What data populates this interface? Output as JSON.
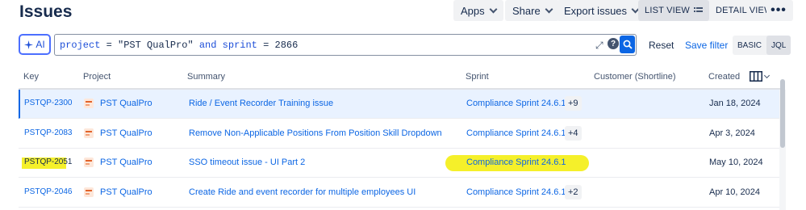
{
  "page": {
    "title": "Issues"
  },
  "toolbar": {
    "apps": "Apps",
    "share": "Share",
    "export": "Export issues",
    "list_view": "LIST VIEW",
    "detail_view": "DETAIL VIEW",
    "more": "•••"
  },
  "search": {
    "ai_label": "AI",
    "query_parts": {
      "field1": "project",
      "op1": " = ",
      "value1": "\"PST QualPro\"",
      "and": " and ",
      "field2": "sprint",
      "op2": " = ",
      "value2": "2866"
    },
    "reset": "Reset",
    "save_filter": "Save filter",
    "mode_basic": "BASIC",
    "mode_jql": "JQL"
  },
  "table": {
    "columns": [
      "Key",
      "Project",
      "Summary",
      "Sprint",
      "Customer (Shortline)",
      "Created"
    ],
    "rows": [
      {
        "key": "PSTQP-2300",
        "project": "PST QualPro",
        "summary": "Ride / Event Recorder Training issue",
        "sprint": "Compliance Sprint 24.6.1",
        "sprint_more": "+9",
        "customer": "",
        "created": "Jan 18, 2024"
      },
      {
        "key": "PSTQP-2083",
        "project": "PST QualPro",
        "summary": "Remove Non-Applicable Positions From Position Skill Dropdown",
        "sprint": "Compliance Sprint 24.6.1",
        "sprint_more": "+4",
        "customer": "",
        "created": "Apr 3, 2024"
      },
      {
        "key": "PSTQP-2051",
        "project": "PST QualPro",
        "summary": "SSO timeout issue - UI Part 2",
        "sprint": "Compliance Sprint 24.6.1",
        "sprint_more": "",
        "customer": "",
        "created": "May 10, 2024"
      },
      {
        "key": "PSTQP-2046",
        "project": "PST QualPro",
        "summary": "Create Ride and event recorder for multiple employees UI",
        "sprint": "Compliance Sprint 24.6.1",
        "sprint_more": "+2",
        "customer": "",
        "created": "Apr 10, 2024"
      }
    ]
  },
  "colors": {
    "link": "#0c66e4",
    "highlight": "#f5f02a",
    "selected_row": "#e9f2ff"
  }
}
